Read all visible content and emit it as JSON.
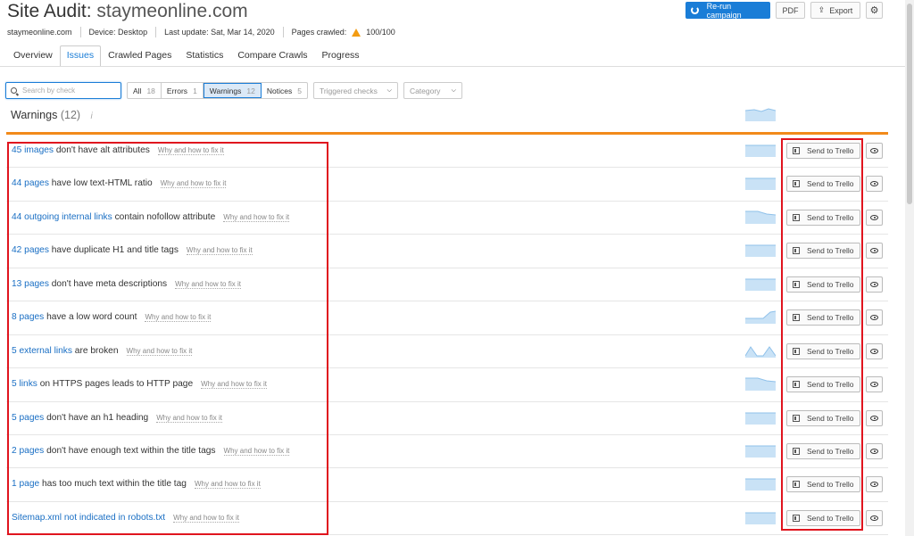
{
  "header": {
    "title_prefix": "Site Audit: ",
    "title_domain": "staymeonline.com",
    "meta_domain": "staymeonline.com",
    "device": "Device: Desktop",
    "last_update": "Last update: Sat, Mar 14, 2020",
    "pages_crawled_label": "Pages crawled:",
    "pages_crawled_value": "100/100"
  },
  "actions": {
    "rerun": "Re-run campaign",
    "pdf": "PDF",
    "export": "Export"
  },
  "tabs": [
    {
      "label": "Overview"
    },
    {
      "label": "Issues",
      "active": true
    },
    {
      "label": "Crawled Pages"
    },
    {
      "label": "Statistics"
    },
    {
      "label": "Compare Crawls"
    },
    {
      "label": "Progress"
    }
  ],
  "filters": {
    "search_placeholder": "Search by check",
    "segments": [
      {
        "label": "All",
        "count": "18"
      },
      {
        "label": "Errors",
        "count": "1"
      },
      {
        "label": "Warnings",
        "count": "12"
      },
      {
        "label": "Notices",
        "count": "5"
      }
    ],
    "triggered_checks": "Triggered checks",
    "category": "Category"
  },
  "section": {
    "title": "Warnings",
    "count": "(12)",
    "info": "i"
  },
  "issues": [
    {
      "link": "45 images",
      "text": "don't have alt attributes",
      "why": "Why and how to fix it",
      "trend": "flat"
    },
    {
      "link": "44 pages",
      "text": "have low text-HTML ratio",
      "why": "Why and how to fix it",
      "trend": "flat"
    },
    {
      "link": "44 outgoing internal links",
      "text": "contain nofollow attribute",
      "why": "Why and how to fix it",
      "trend": "down"
    },
    {
      "link": "42 pages",
      "text": "have duplicate H1 and title tags",
      "why": "Why and how to fix it",
      "trend": "flat"
    },
    {
      "link": "13 pages",
      "text": "don't have meta descriptions",
      "why": "Why and how to fix it",
      "trend": "flat"
    },
    {
      "link": "8 pages",
      "text": "have a low word count",
      "why": "Why and how to fix it",
      "trend": "up"
    },
    {
      "link": "5 external links",
      "text": "are broken",
      "why": "Why and how to fix it",
      "trend": "peak"
    },
    {
      "link": "5 links",
      "text": "on HTTPS pages leads to HTTP page",
      "why": "Why and how to fix it",
      "trend": "down"
    },
    {
      "link": "5 pages",
      "text": "don't have an h1 heading",
      "why": "Why and how to fix it",
      "trend": "flat"
    },
    {
      "link": "2 pages",
      "text": "don't have enough text within the title tags",
      "why": "Why and how to fix it",
      "trend": "flat"
    },
    {
      "link": "1 page",
      "text": "has too much text within the title tag",
      "why": "Why and how to fix it",
      "trend": "flat"
    },
    {
      "link": "Sitemap.xml not indicated in robots.txt",
      "text": "",
      "why": "Why and how to fix it",
      "trend": "flat"
    }
  ],
  "row_button": "Send to Trello",
  "colors": {
    "accent": "#1a7dd7",
    "warning_bar": "#f28a1a",
    "highlight": "#e0141e",
    "spark_fill": "#c9e2f6"
  }
}
